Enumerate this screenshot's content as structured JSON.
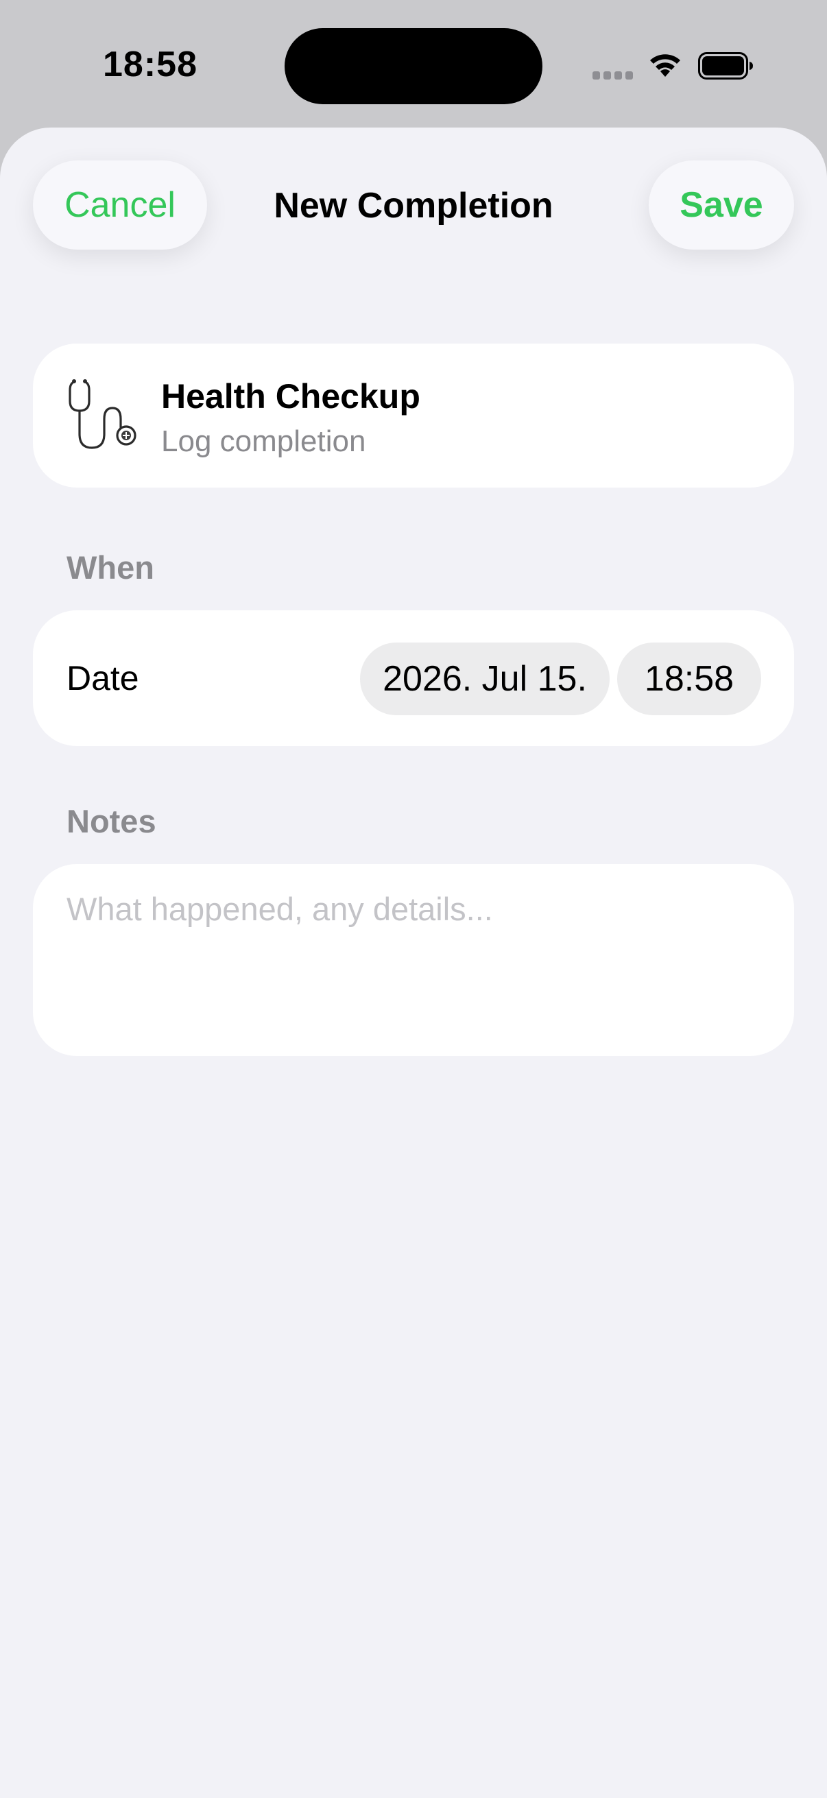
{
  "status_bar": {
    "time": "18:58"
  },
  "nav": {
    "cancel_label": "Cancel",
    "title": "New Completion",
    "save_label": "Save"
  },
  "habit": {
    "icon": "stethoscope-icon",
    "title": "Health Checkup",
    "subtitle": "Log completion"
  },
  "when": {
    "section_label": "When",
    "date_label": "Date",
    "date_value": "2026. Jul 15.",
    "time_value": "18:58"
  },
  "notes": {
    "section_label": "Notes",
    "placeholder": "What happened, any details...",
    "value": ""
  },
  "colors": {
    "accent": "#34c759",
    "background": "#f2f2f7",
    "secondary_text": "#8a8a8e"
  }
}
